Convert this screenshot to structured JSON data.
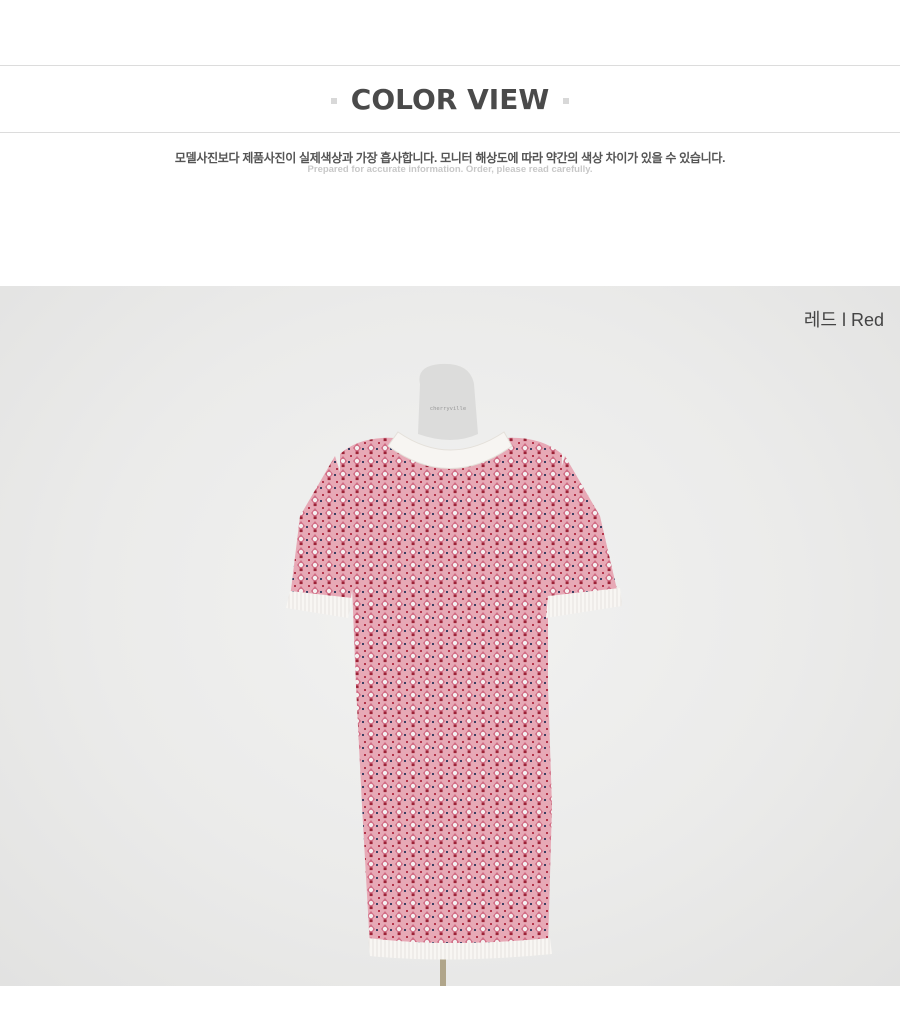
{
  "section": {
    "title": "COLOR VIEW",
    "notice_ko": "모델사진보다 제품사진이 실제색상과 가장 흡사합니다. 모니터 해상도에 따라 약간의 색상 차이가 있을 수 있습니다.",
    "notice_en": "Prepared for accurate information. Order, please read carefully."
  },
  "product_image": {
    "color_label": "레드 l Red",
    "mannequin_tag": "cherryville",
    "colors": {
      "pattern_pink": "#d98a9c",
      "pattern_red": "#a8283c",
      "trim_white": "#f7f5f2",
      "background": "#ebebea"
    }
  }
}
